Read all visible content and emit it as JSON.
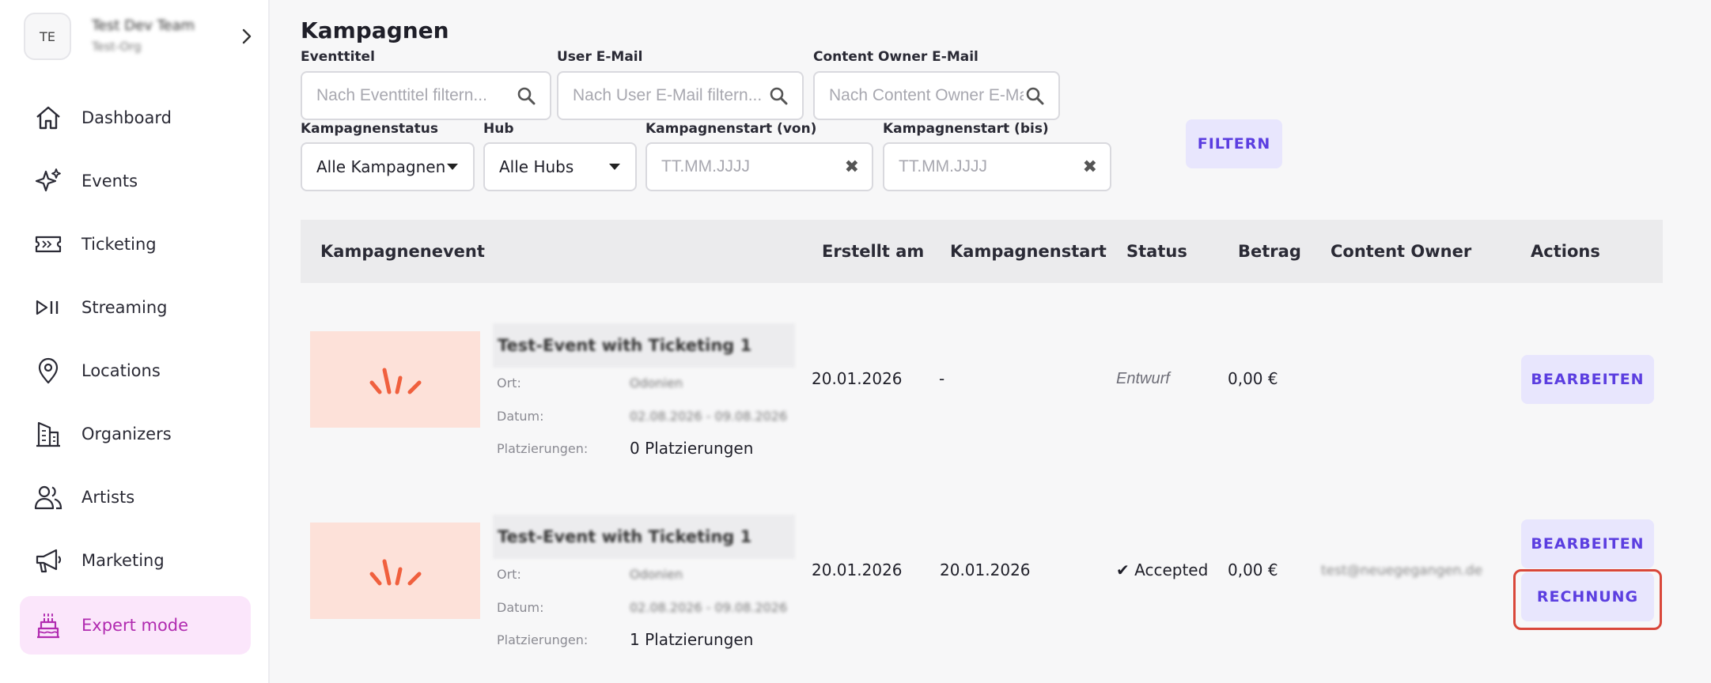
{
  "sidebar": {
    "team": {
      "initials": "TE",
      "name": "Test Dev Team",
      "org": "Test-Org"
    },
    "items": [
      {
        "label": "Dashboard",
        "icon": "home-icon"
      },
      {
        "label": "Events",
        "icon": "sparkles-icon"
      },
      {
        "label": "Ticketing",
        "icon": "ticket-icon"
      },
      {
        "label": "Streaming",
        "icon": "play-pause-icon"
      },
      {
        "label": "Locations",
        "icon": "map-pin-icon"
      },
      {
        "label": "Organizers",
        "icon": "buildings-icon"
      },
      {
        "label": "Artists",
        "icon": "users-icon"
      },
      {
        "label": "Marketing",
        "icon": "megaphone-icon"
      },
      {
        "label": "Expert mode",
        "icon": "cake-icon",
        "active": true
      }
    ]
  },
  "header": {
    "title": "Kampagnen"
  },
  "filters": {
    "eventtitel": {
      "label": "Eventtitel",
      "placeholder": "Nach Eventtitel filtern..."
    },
    "user_email": {
      "label": "User E-Mail",
      "placeholder": "Nach User E-Mail filtern..."
    },
    "owner_email": {
      "label": "Content Owner E-Mail",
      "placeholder": "Nach Content Owner E-Mail filtern..."
    },
    "status": {
      "label": "Kampagnenstatus",
      "value": "Alle Kampagnen"
    },
    "hub": {
      "label": "Hub",
      "value": "Alle Hubs"
    },
    "start_von": {
      "label": "Kampagnenstart (von)",
      "placeholder": "TT.MM.JJJJ"
    },
    "start_bis": {
      "label": "Kampagnenstart (bis)",
      "placeholder": "TT.MM.JJJJ"
    },
    "submit_label": "FILTERN"
  },
  "table": {
    "columns": [
      "Kampagnenevent",
      "Erstellt am",
      "Kampagnenstart",
      "Status",
      "Betrag",
      "Content Owner",
      "Actions"
    ],
    "meta_labels": {
      "ort": "Ort:",
      "datum": "Datum:",
      "platzierungen": "Platzierungen:"
    },
    "rows": [
      {
        "event_title": "Test-Event with Ticketing 1",
        "ort": "Odonien",
        "datum": "02.08.2026 - 09.08.2026",
        "platzierungen": "0 Platzierungen",
        "erstellt_am": "20.01.2026",
        "kampagnenstart": "-",
        "status": "Entwurf",
        "status_check": "",
        "betrag": "0,00 €",
        "content_owner": "",
        "actions": [
          "BEARBEITEN"
        ]
      },
      {
        "event_title": "Test-Event with Ticketing 1",
        "ort": "Odonien",
        "datum": "02.08.2026 - 09.08.2026",
        "platzierungen": "1 Platzierungen",
        "erstellt_am": "20.01.2026",
        "kampagnenstart": "20.01.2026",
        "status": "Accepted",
        "status_check": "✔",
        "betrag": "0,00 €",
        "content_owner": "test@neuegegangen.de",
        "actions": [
          "BEARBEITEN",
          "RECHNUNG"
        ]
      }
    ]
  },
  "colors": {
    "accent": "#5b3ee0",
    "button_bg": "#e8e6fd",
    "active_nav_bg": "#fbe6fb",
    "active_nav_text": "#b12bb0",
    "thumb_bg": "#fde1d9",
    "thumb_icon": "#f0603e",
    "highlight": "#d9473a"
  }
}
